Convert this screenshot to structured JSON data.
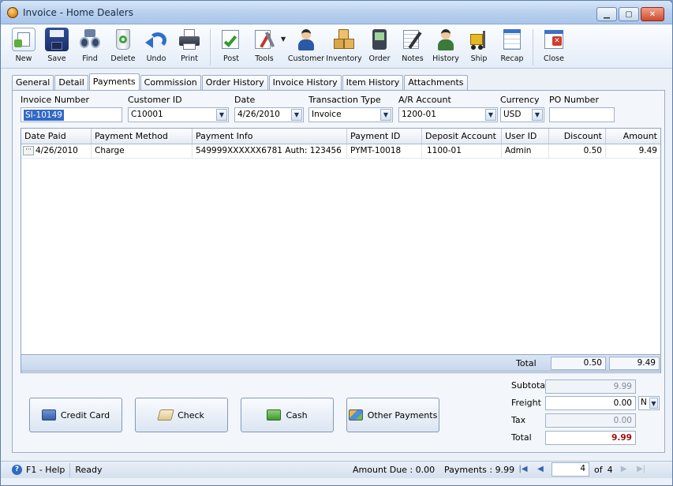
{
  "window": {
    "title": "Invoice - Home Dealers"
  },
  "toolbar": [
    {
      "label": "New",
      "icon": "new-document-icon"
    },
    {
      "label": "Save",
      "icon": "floppy-disk-icon"
    },
    {
      "label": "Find",
      "icon": "binoculars-icon"
    },
    {
      "label": "Delete",
      "icon": "recycle-bin-icon"
    },
    {
      "label": "Undo",
      "icon": "undo-arrow-icon"
    },
    {
      "label": "Print",
      "icon": "printer-icon"
    },
    {
      "label": "Post",
      "icon": "post-checkmark-icon"
    },
    {
      "label": "Tools",
      "icon": "tools-icon"
    },
    {
      "label": "Customer",
      "icon": "customer-person-icon"
    },
    {
      "label": "Inventory",
      "icon": "boxes-icon"
    },
    {
      "label": "Order",
      "icon": "order-device-icon"
    },
    {
      "label": "Notes",
      "icon": "notepad-pen-icon"
    },
    {
      "label": "History",
      "icon": "history-person-icon"
    },
    {
      "label": "Ship",
      "icon": "forklift-icon"
    },
    {
      "label": "Recap",
      "icon": "recap-sheet-icon"
    },
    {
      "label": "Close",
      "icon": "close-window-icon"
    }
  ],
  "tabs": [
    "General",
    "Detail",
    "Payments",
    "Commission",
    "Order History",
    "Invoice History",
    "Item History",
    "Attachments"
  ],
  "active_tab": "Payments",
  "header": {
    "invoice_number_label": "Invoice Number",
    "invoice_number": "SI-10149",
    "customer_id_label": "Customer ID",
    "customer_id": "C10001",
    "date_label": "Date",
    "date": "4/26/2010",
    "transaction_type_label": "Transaction Type",
    "transaction_type": "Invoice",
    "ar_account_label": "A/R Account",
    "ar_account": "1200-01",
    "currency_label": "Currency",
    "currency": "USD",
    "po_number_label": "PO Number",
    "po_number": ""
  },
  "grid": {
    "columns": [
      "Date Paid",
      "Payment Method",
      "Payment Info",
      "Payment ID",
      "Deposit Account",
      "User ID",
      "Discount",
      "Amount"
    ],
    "rows": [
      {
        "date_paid": "4/26/2010",
        "payment_method": "Charge",
        "payment_info": "549999XXXXXX6781 Auth: 123456",
        "payment_id": "PYMT-10018",
        "deposit_account": "1100-01",
        "user_id": "Admin",
        "discount": "0.50",
        "amount": "9.49"
      }
    ],
    "total_label": "Total",
    "total_discount": "0.50",
    "total_amount": "9.49"
  },
  "payment_buttons": [
    {
      "label": "Credit Card",
      "icon": "credit-card-icon"
    },
    {
      "label": "Check",
      "icon": "check-pen-icon"
    },
    {
      "label": "Cash",
      "icon": "cash-bills-icon"
    },
    {
      "label": "Other Payments",
      "icon": "other-payments-icon"
    }
  ],
  "summary": {
    "subtotal_label": "Subtotal",
    "subtotal": "9.99",
    "freight_label": "Freight",
    "freight": "0.00",
    "freight_type": "N",
    "tax_label": "Tax",
    "tax": "0.00",
    "total_label": "Total",
    "total": "9.99"
  },
  "status": {
    "help": "F1 - Help",
    "state": "Ready",
    "amount_due": "Amount Due : 0.00",
    "payments": "Payments : 9.99",
    "current_page": "4",
    "of_label": "of",
    "total_pages": "4"
  }
}
